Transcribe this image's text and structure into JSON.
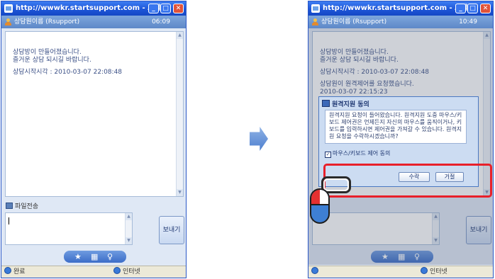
{
  "left": {
    "title": "http://wwwkr.startsupport.com - 고객...",
    "header": {
      "agent": "상담원이름 (Rsupport)",
      "time": "06:09"
    },
    "chat": {
      "line1": "상담방이 만들어졌습니다.",
      "line2": "즐거운 상담 되시길 바랍니다.",
      "line3": "상담시작시각 : 2010-03-07 22:08:48"
    },
    "file_transfer": "파일전송",
    "send_label": "보내기",
    "status": {
      "done": "완료",
      "zone": "인터넷"
    }
  },
  "right": {
    "title": "http://wwwkr.startsupport.com - 고객...",
    "header": {
      "agent": "상담원이름 (Rsupport)",
      "time": "10:49"
    },
    "chat": {
      "line1": "상담방이 만들어졌습니다.",
      "line2": "즐거운 상담 되시길 바랍니다.",
      "line3": "상담시작시각 : 2010-03-07 22:08:48",
      "line4": "상담원이 원격제어를 요청했습니다.",
      "line5": "2010-03-07 22:15:23"
    },
    "dialog": {
      "title": "원격지원 동의",
      "body": "원격지원 요청이 들어왔습니다. 원격지원 도중 마우스/키보드 제어권은 언제든지 자신의 마우스를 움직이거나, 키보드를 입력하시면 제어권을 가져갈 수 있습니다. 원격지원 요청을 수락하시겠습니까?",
      "checkbox": "마우스/키보드 제어 동의",
      "accept": "수락",
      "reject": "거절"
    },
    "file_transfer_partial": "송",
    "send_label": "보내기",
    "status": {
      "zone": "인터넷"
    }
  },
  "toolbar_icons": [
    "star-icon",
    "grid-icon",
    "support-icon"
  ]
}
